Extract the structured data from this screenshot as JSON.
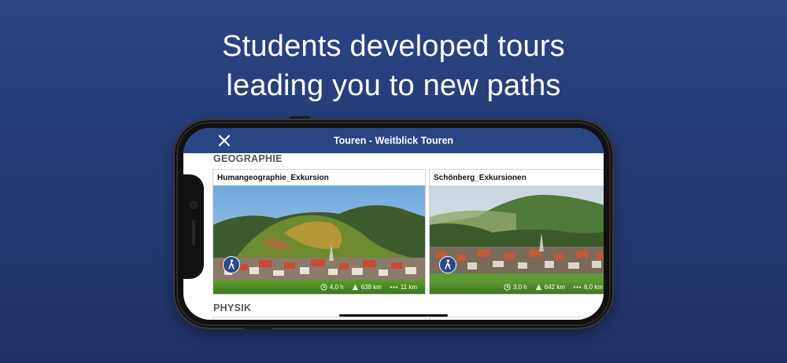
{
  "marketing": {
    "line1": "Students developed tours",
    "line2": "leading you to new paths"
  },
  "app": {
    "nav_title": "Touren - Weitblick Touren",
    "close_icon": "close-icon"
  },
  "sections": [
    {
      "title": "GEOGRAPHIE",
      "cards": [
        {
          "title": "Humangeographie_Exkursion",
          "duration": "4,0 h",
          "elevation": "638 km",
          "distance": "11 km"
        },
        {
          "title": "Schönberg_Exkursionen",
          "duration": "3,0 h",
          "elevation": "642 km",
          "distance": "6,0 km"
        }
      ]
    },
    {
      "title": "PHYSIK",
      "cards": []
    }
  ],
  "colors": {
    "background": "#2a4585",
    "navbar": "#2a4585",
    "badge": "#2a4a8e"
  }
}
